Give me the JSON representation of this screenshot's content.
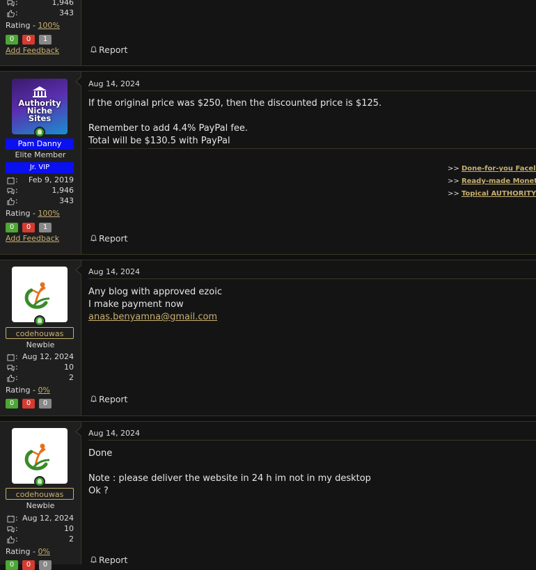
{
  "posts": [
    {
      "stats": {
        "messages": "1,946",
        "reactions": "343"
      },
      "rating": {
        "label": "Rating - ",
        "value": "100%"
      },
      "badges": [
        "0",
        "0",
        "1"
      ],
      "add_feedback": "Add Feedback",
      "report": "Report"
    },
    {
      "user": {
        "name": "Pam Danny",
        "title": "Elite Member",
        "group": "Jr. VIP"
      },
      "avatar": {
        "line1": "Authority",
        "line2": "Niche",
        "line3": "Sites"
      },
      "stats": {
        "joined": "Feb 9, 2019",
        "messages": "1,946",
        "reactions": "343"
      },
      "rating": {
        "label": "Rating - ",
        "value": "100%"
      },
      "badges": [
        "0",
        "0",
        "1"
      ],
      "add_feedback": "Add Feedback",
      "date": "Aug 14, 2024",
      "body": [
        "If the original price was $250, then the discounted price is $125.",
        "Remember to add 4.4% PayPal fee.",
        "Total will be $130.5 with PayPal"
      ],
      "signature": [
        {
          "prefix": ">> ",
          "text": "Done-for-you Faceless C"
        },
        {
          "prefix": ">> ",
          "text": "Ready-made Monetized"
        },
        {
          "prefix": ">> ",
          "text": "Topical AUTHORITY Ads"
        }
      ],
      "report": "Report"
    },
    {
      "user": {
        "name": "codehouwas",
        "title": "Newbie"
      },
      "stats": {
        "joined": "Aug 12, 2024",
        "messages": "10",
        "reactions": "2"
      },
      "rating": {
        "label": "Rating - ",
        "value": "0%"
      },
      "badges": [
        "0",
        "0",
        "0"
      ],
      "date": "Aug 14, 2024",
      "body": [
        "Any blog with approved ezoic",
        "I make payment now",
        "anas.benyamna@gmail.com"
      ],
      "report": "Report"
    },
    {
      "user": {
        "name": "codehouwas",
        "title": "Newbie"
      },
      "stats": {
        "joined": "Aug 12, 2024",
        "messages": "10",
        "reactions": "2"
      },
      "rating": {
        "label": "Rating - ",
        "value": "0%"
      },
      "badges": [
        "0",
        "0",
        "0"
      ],
      "date": "Aug 14, 2024",
      "body": [
        "Done",
        "Note : please deliver the website in 24 h im not in my desktop",
        "Ok ?"
      ],
      "report": "Report"
    }
  ],
  "colors": {
    "accent": "#c8b070",
    "vip_blue": "#0b10f0",
    "green": "#4da634",
    "red": "#d63b2f",
    "gray": "#888888"
  }
}
